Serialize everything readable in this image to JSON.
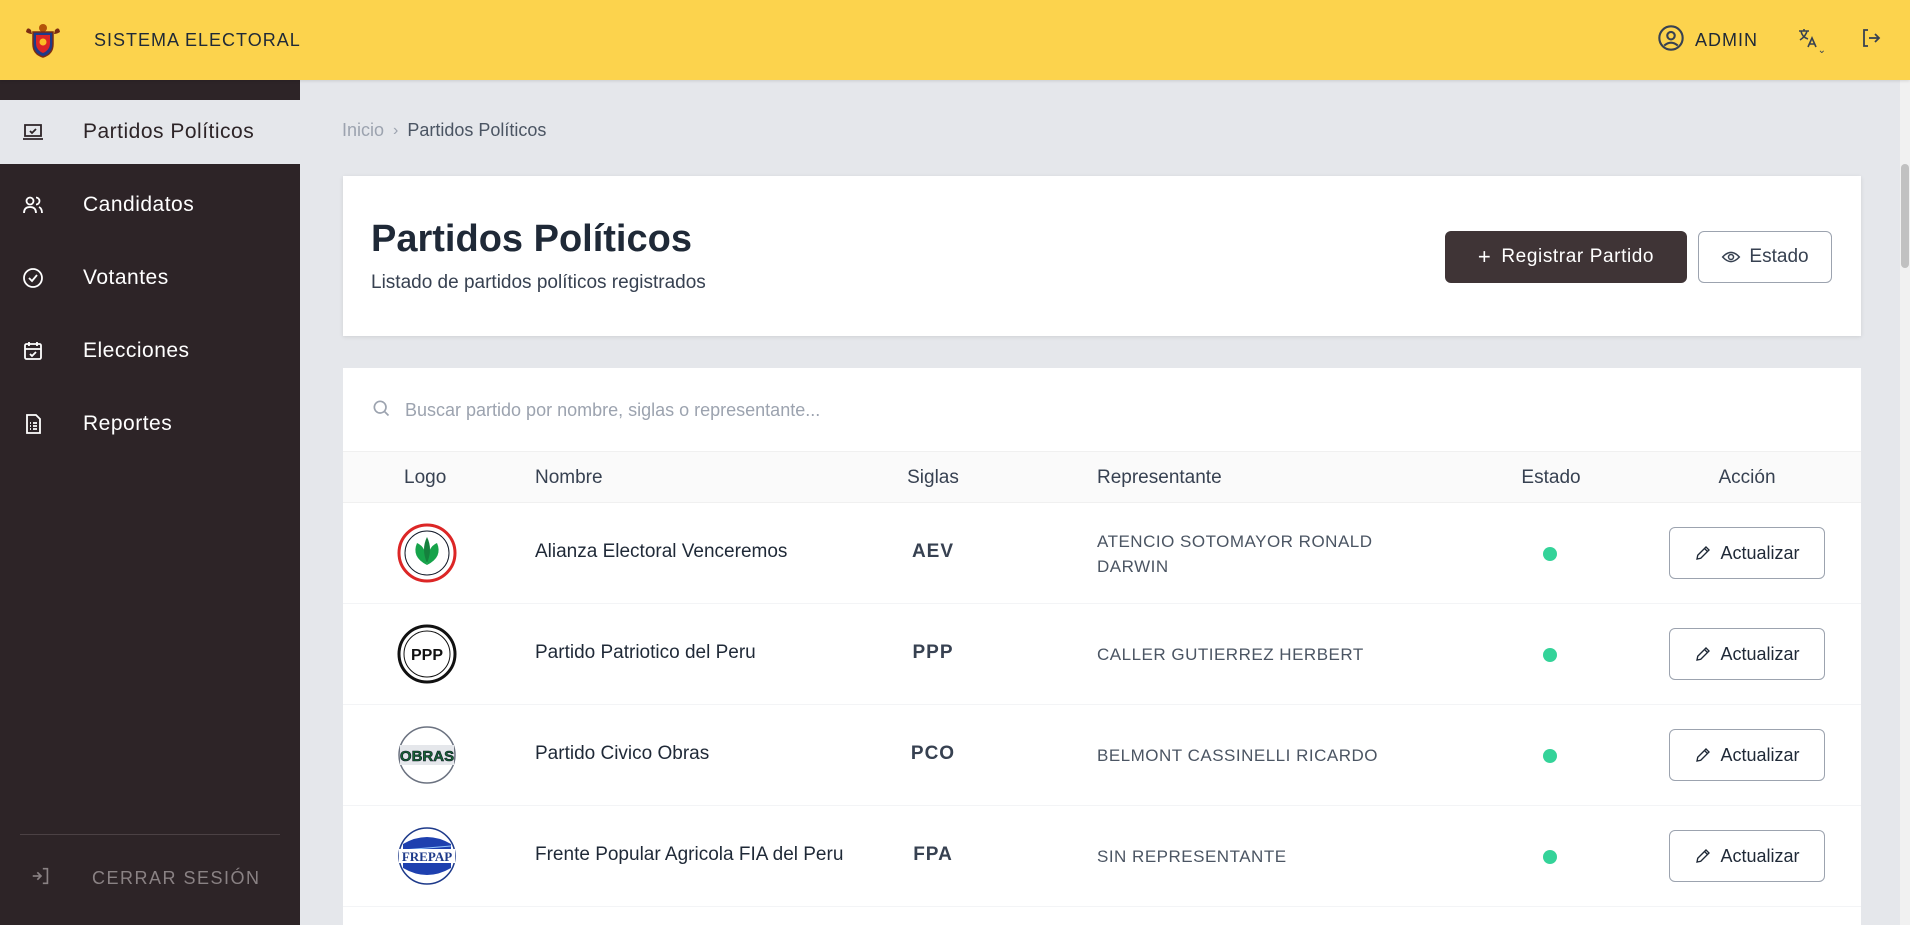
{
  "app": {
    "title": "SISTEMA ELECTORAL"
  },
  "user": {
    "name": "ADMIN"
  },
  "colors": {
    "topbar": "#fcd34d",
    "sidebar": "#2d2427",
    "primary_button": "#3f3436",
    "status_active": "#34d399"
  },
  "sidebar": {
    "items": [
      {
        "label": "Partidos Políticos",
        "icon": "monitor-check-icon",
        "active": true
      },
      {
        "label": "Candidatos",
        "icon": "users-icon",
        "active": false
      },
      {
        "label": "Votantes",
        "icon": "check-circle-icon",
        "active": false
      },
      {
        "label": "Elecciones",
        "icon": "calendar-check-icon",
        "active": false
      },
      {
        "label": "Reportes",
        "icon": "file-text-icon",
        "active": false
      }
    ],
    "logout_label": "CERRAR SESIÓN"
  },
  "breadcrumb": {
    "home": "Inicio",
    "separator": "›",
    "current": "Partidos Políticos"
  },
  "header": {
    "title": "Partidos Políticos",
    "subtitle": "Listado de partidos políticos registrados",
    "register_button": "Registrar Partido",
    "register_icon": "+",
    "estado_button": "Estado"
  },
  "search": {
    "placeholder": "Buscar partido por nombre, siglas o representante..."
  },
  "table": {
    "columns": [
      "Logo",
      "Nombre",
      "Siglas",
      "Representante",
      "Estado",
      "Acción"
    ],
    "action_label": "Actualizar",
    "rows": [
      {
        "name": "Alianza Electoral Venceremos",
        "sigla": "AEV",
        "rep": "ATENCIO SOTOMAYOR RONALD DARWIN",
        "logo": "AEV leaf logo"
      },
      {
        "name": "Partido Patriotico del Peru",
        "sigla": "PPP",
        "rep": "CALLER GUTIERREZ HERBERT",
        "logo": "PPP",
        "logo_text": "PPP"
      },
      {
        "name": "Partido Civico Obras",
        "sigla": "PCO",
        "rep": "BELMONT CASSINELLI RICARDO",
        "logo": "OBRAS",
        "logo_text": "OBRAS"
      },
      {
        "name": "Frente Popular Agricola FIA del Peru",
        "sigla": "FPA",
        "rep": "SIN REPRESENTANTE",
        "logo": "FREPAP",
        "logo_text": "FREPAP"
      }
    ]
  }
}
